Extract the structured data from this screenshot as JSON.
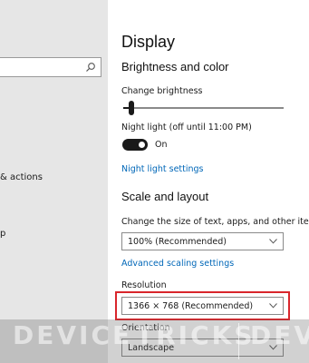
{
  "left_pane": {
    "nav_items": [
      {
        "label": "& actions"
      },
      {
        "label": "p"
      }
    ]
  },
  "main": {
    "title": "Display",
    "brightness_section": {
      "heading": "Brightness and color",
      "change_brightness_label": "Change brightness",
      "brightness_level": 0.05,
      "night_light_label": "Night light (off until 11:00 PM)",
      "night_light_state": "On",
      "night_light_settings_link": "Night light settings"
    },
    "scale_section": {
      "heading": "Scale and layout",
      "text_size_label": "Change the size of text, apps, and other items",
      "scale_value": "100% (Recommended)",
      "advanced_scaling_link": "Advanced scaling settings",
      "resolution_label": "Resolution",
      "resolution_value": "1366 × 768 (Recommended)",
      "orientation_label": "Orientation",
      "orientation_value": "Landscape"
    }
  },
  "watermark": {
    "text_1": "DEVICE",
    "text_2": "TRICKS",
    "text_3": "DEV"
  },
  "colors": {
    "accent": "#0067b8",
    "highlight_border": "#d9262c",
    "left_pane_bg": "#e6e6e6"
  }
}
